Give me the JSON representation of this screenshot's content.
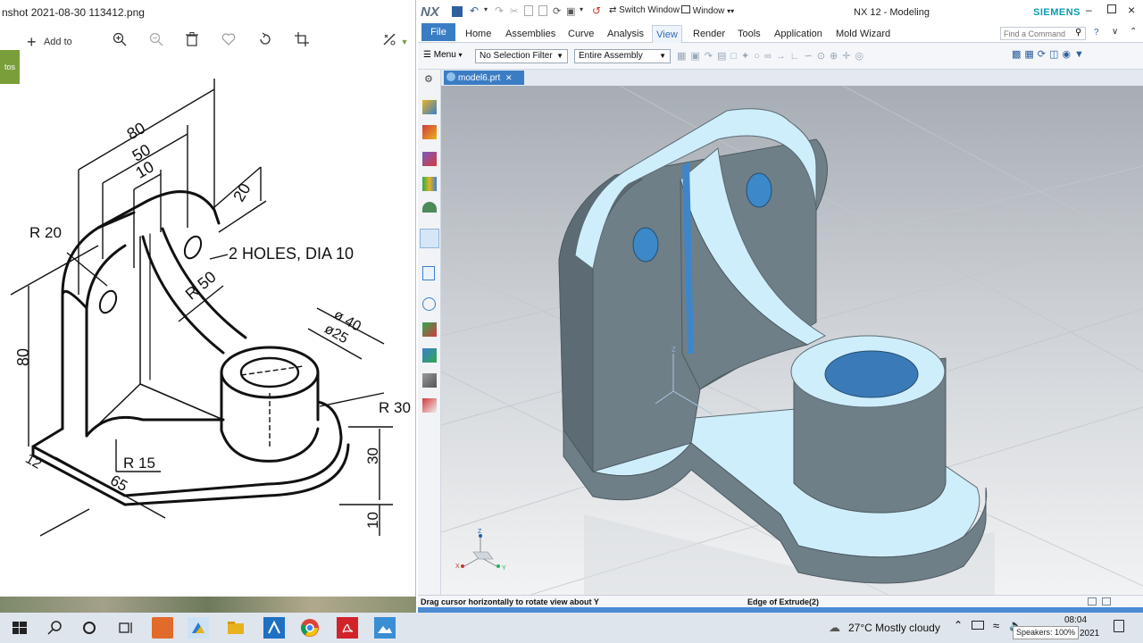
{
  "photos": {
    "title": "nshot 2021-08-30 113412.png",
    "tab_label": "tos",
    "add_to_label": "Add to",
    "drawing": {
      "dims": [
        "80",
        "50",
        "10",
        "20",
        "R 20",
        "2 HOLES, DIA 10",
        "R 50",
        "ø 40",
        "ø25",
        "R 30",
        "80",
        "12",
        "R 15",
        "65",
        "30",
        "10"
      ]
    }
  },
  "nx": {
    "logo": "NX",
    "switch_window": "Switch Window",
    "window_menu": "Window",
    "title": "NX 12 - Modeling",
    "brand": "SIEMENS",
    "file_tab": "File",
    "tabs": [
      "Home",
      "Assemblies",
      "Curve",
      "Analysis",
      "View",
      "Render",
      "Tools",
      "Application",
      "Mold Wizard"
    ],
    "active_tab": "View",
    "search_placeholder": "Find a Command",
    "menu_label": "Menu",
    "selection_filter": "No Selection Filter",
    "assembly_scope": "Entire Assembly",
    "doc_tab": "model6.prt",
    "status_left": "Drag cursor horizontally to rotate view about Y",
    "status_right": "Edge of Extrude(2)",
    "colors": {
      "accent": "#3b7dc4",
      "model": "#6f7f88",
      "highlight": "#cfeefc"
    }
  },
  "taskbar": {
    "weather": "27°C  Mostly cloudy",
    "time": "08:04",
    "date_partial": "2021",
    "tooltip": "Speakers: 100%"
  }
}
